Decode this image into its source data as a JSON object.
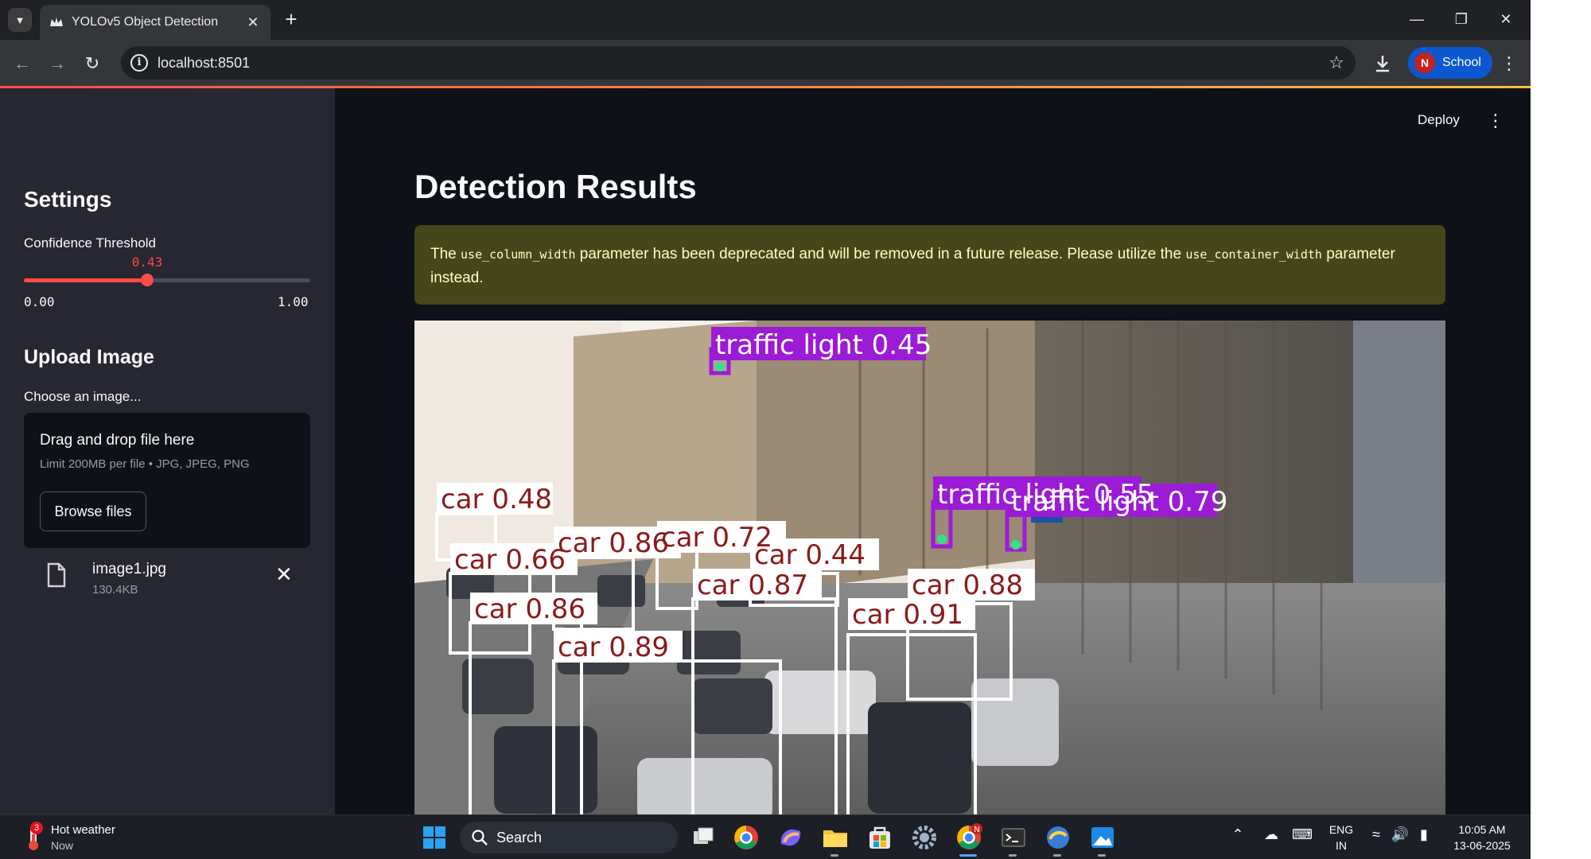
{
  "browser": {
    "tab_title": "YOLOv5 Object Detection",
    "url": "localhost:8501",
    "profile_initial": "N",
    "profile_name": "School"
  },
  "sidebar": {
    "settings_heading": "Settings",
    "slider_label": "Confidence Threshold",
    "slider_value": "0.43",
    "slider_value_fraction": 0.43,
    "slider_min": "0.00",
    "slider_max": "1.00",
    "upload_heading": "Upload Image",
    "upload_label": "Choose an image...",
    "dropzone_title": "Drag and drop file here",
    "dropzone_hint": "Limit 200MB per file • JPG, JPEG, PNG",
    "browse_label": "Browse files",
    "file_name": "image1.jpg",
    "file_size": "130.4KB"
  },
  "main": {
    "deploy_label": "Deploy",
    "title": "Detection Results",
    "warning": {
      "part1": "The ",
      "code1": "use_column_width",
      "part2": " parameter has been deprecated and will be removed in a future release. Please utilize the ",
      "code2": "use_container_width",
      "part3": " parameter instead."
    },
    "detections": [
      {
        "label": "traffic light 0.45",
        "class": "traffic light"
      },
      {
        "label": "traffic light 0.55",
        "class": "traffic light"
      },
      {
        "label": "traffic light 0.79",
        "class": "traffic light"
      },
      {
        "label": "car 0.48",
        "class": "car"
      },
      {
        "label": "car 0.86",
        "class": "car"
      },
      {
        "label": "car 0.72",
        "class": "car"
      },
      {
        "label": "car 0.66",
        "class": "car"
      },
      {
        "label": "car 0.44",
        "class": "car"
      },
      {
        "label": "car 0.87",
        "class": "car"
      },
      {
        "label": "car 0.88",
        "class": "car"
      },
      {
        "label": "car 0.86",
        "class": "car"
      },
      {
        "label": "car 0.91",
        "class": "car"
      },
      {
        "label": "car 0.89",
        "class": "car"
      }
    ]
  },
  "taskbar": {
    "weather_badge": "3",
    "weather_title": "Hot weather",
    "weather_sub": "Now",
    "search_placeholder": "Search",
    "lang_line1": "ENG",
    "lang_line2": "IN",
    "time": "10:05 AM",
    "date": "13-06-2025",
    "chrome_badge": "N"
  },
  "colors": {
    "accent": "#ff4b4b",
    "car_box": "#8b1a1a",
    "traffic_light_box": "#9b1bd6",
    "warning_bg": "#46461b",
    "warning_text": "#ffffc2"
  }
}
